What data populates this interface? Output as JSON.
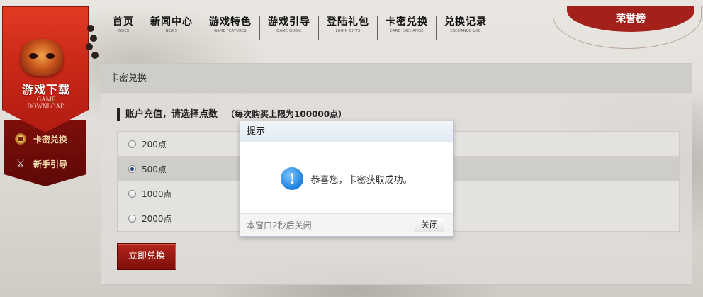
{
  "sidebar": {
    "download_title": "游戏下载",
    "download_sub_line1": "GAME",
    "download_sub_line2": "DOWNLOAD",
    "items": [
      {
        "label": "卡密兑换",
        "icon": "coin-icon"
      },
      {
        "label": "新手引导",
        "icon": "swords-icon"
      }
    ]
  },
  "nav": {
    "items": [
      {
        "zh": "首页",
        "en": "INDEX"
      },
      {
        "zh": "新闻中心",
        "en": "NEWS"
      },
      {
        "zh": "游戏特色",
        "en": "GAME FEATURES"
      },
      {
        "zh": "游戏引导",
        "en": "GAME GUIDE"
      },
      {
        "zh": "登陆礼包",
        "en": "LOGIN GIFTS"
      },
      {
        "zh": "卡密兑换",
        "en": "CARD EXCHANGE"
      },
      {
        "zh": "兑换记录",
        "en": "EXCHANGE LOG"
      }
    ],
    "rank_label": "荣誉榜"
  },
  "panel": {
    "title": "卡密兑换",
    "section_title": "账户充值，请选择点数",
    "section_note": "（每次购买上限为100000点）",
    "options": [
      {
        "label": "200点",
        "selected": false
      },
      {
        "label": "500点",
        "selected": true
      },
      {
        "label": "1000点",
        "selected": false
      },
      {
        "label": "2000点",
        "selected": false
      }
    ],
    "redeem_button": "立即兑换"
  },
  "dialog": {
    "title": "提示",
    "icon": "info-icon",
    "message": "恭喜您，卡密获取成功。",
    "auto_close_text": "本窗口2秒后关闭",
    "close_button": "关闭"
  },
  "colors": {
    "ribbon_red": "#c62617",
    "button_red": "#9a1a12",
    "info_blue": "#1b7fde"
  }
}
